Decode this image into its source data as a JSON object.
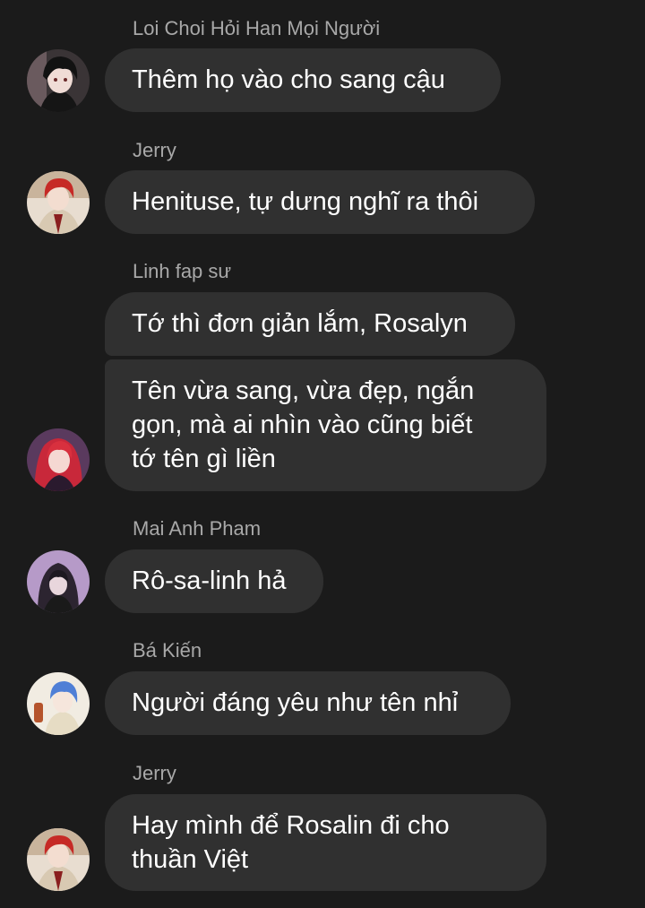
{
  "messages": [
    {
      "sender": "Loi Choi Hỏi Han Mọi Người",
      "avatar": "dark-haired-boy-avatar-icon",
      "texts": [
        "Thêm họ vào cho sang cậu"
      ]
    },
    {
      "sender": "Jerry",
      "avatar": "red-haired-man-avatar-icon",
      "texts": [
        "Henituse, tự dưng nghĩ ra thôi"
      ]
    },
    {
      "sender": "Linh fap sư",
      "avatar": "red-haired-girl-avatar-icon",
      "texts": [
        "Tớ thì đơn giản lắm, Rosalyn",
        "Tên vừa sang, vừa đẹp, ngắn\ngọn, mà ai nhìn vào cũng biết\ntớ tên gì liền"
      ]
    },
    {
      "sender": "Mai Anh Pham",
      "avatar": "hooded-figure-avatar-icon",
      "texts": [
        "Rô-sa-linh hả"
      ]
    },
    {
      "sender": "Bá Kiến",
      "avatar": "blue-haired-avatar-icon",
      "texts": [
        "Người đáng yêu như tên nhỉ"
      ]
    },
    {
      "sender": "Jerry",
      "avatar": "red-haired-man-avatar-icon",
      "texts": [
        "Hay mình để Rosalin đi cho\nthuần Việt"
      ]
    }
  ]
}
